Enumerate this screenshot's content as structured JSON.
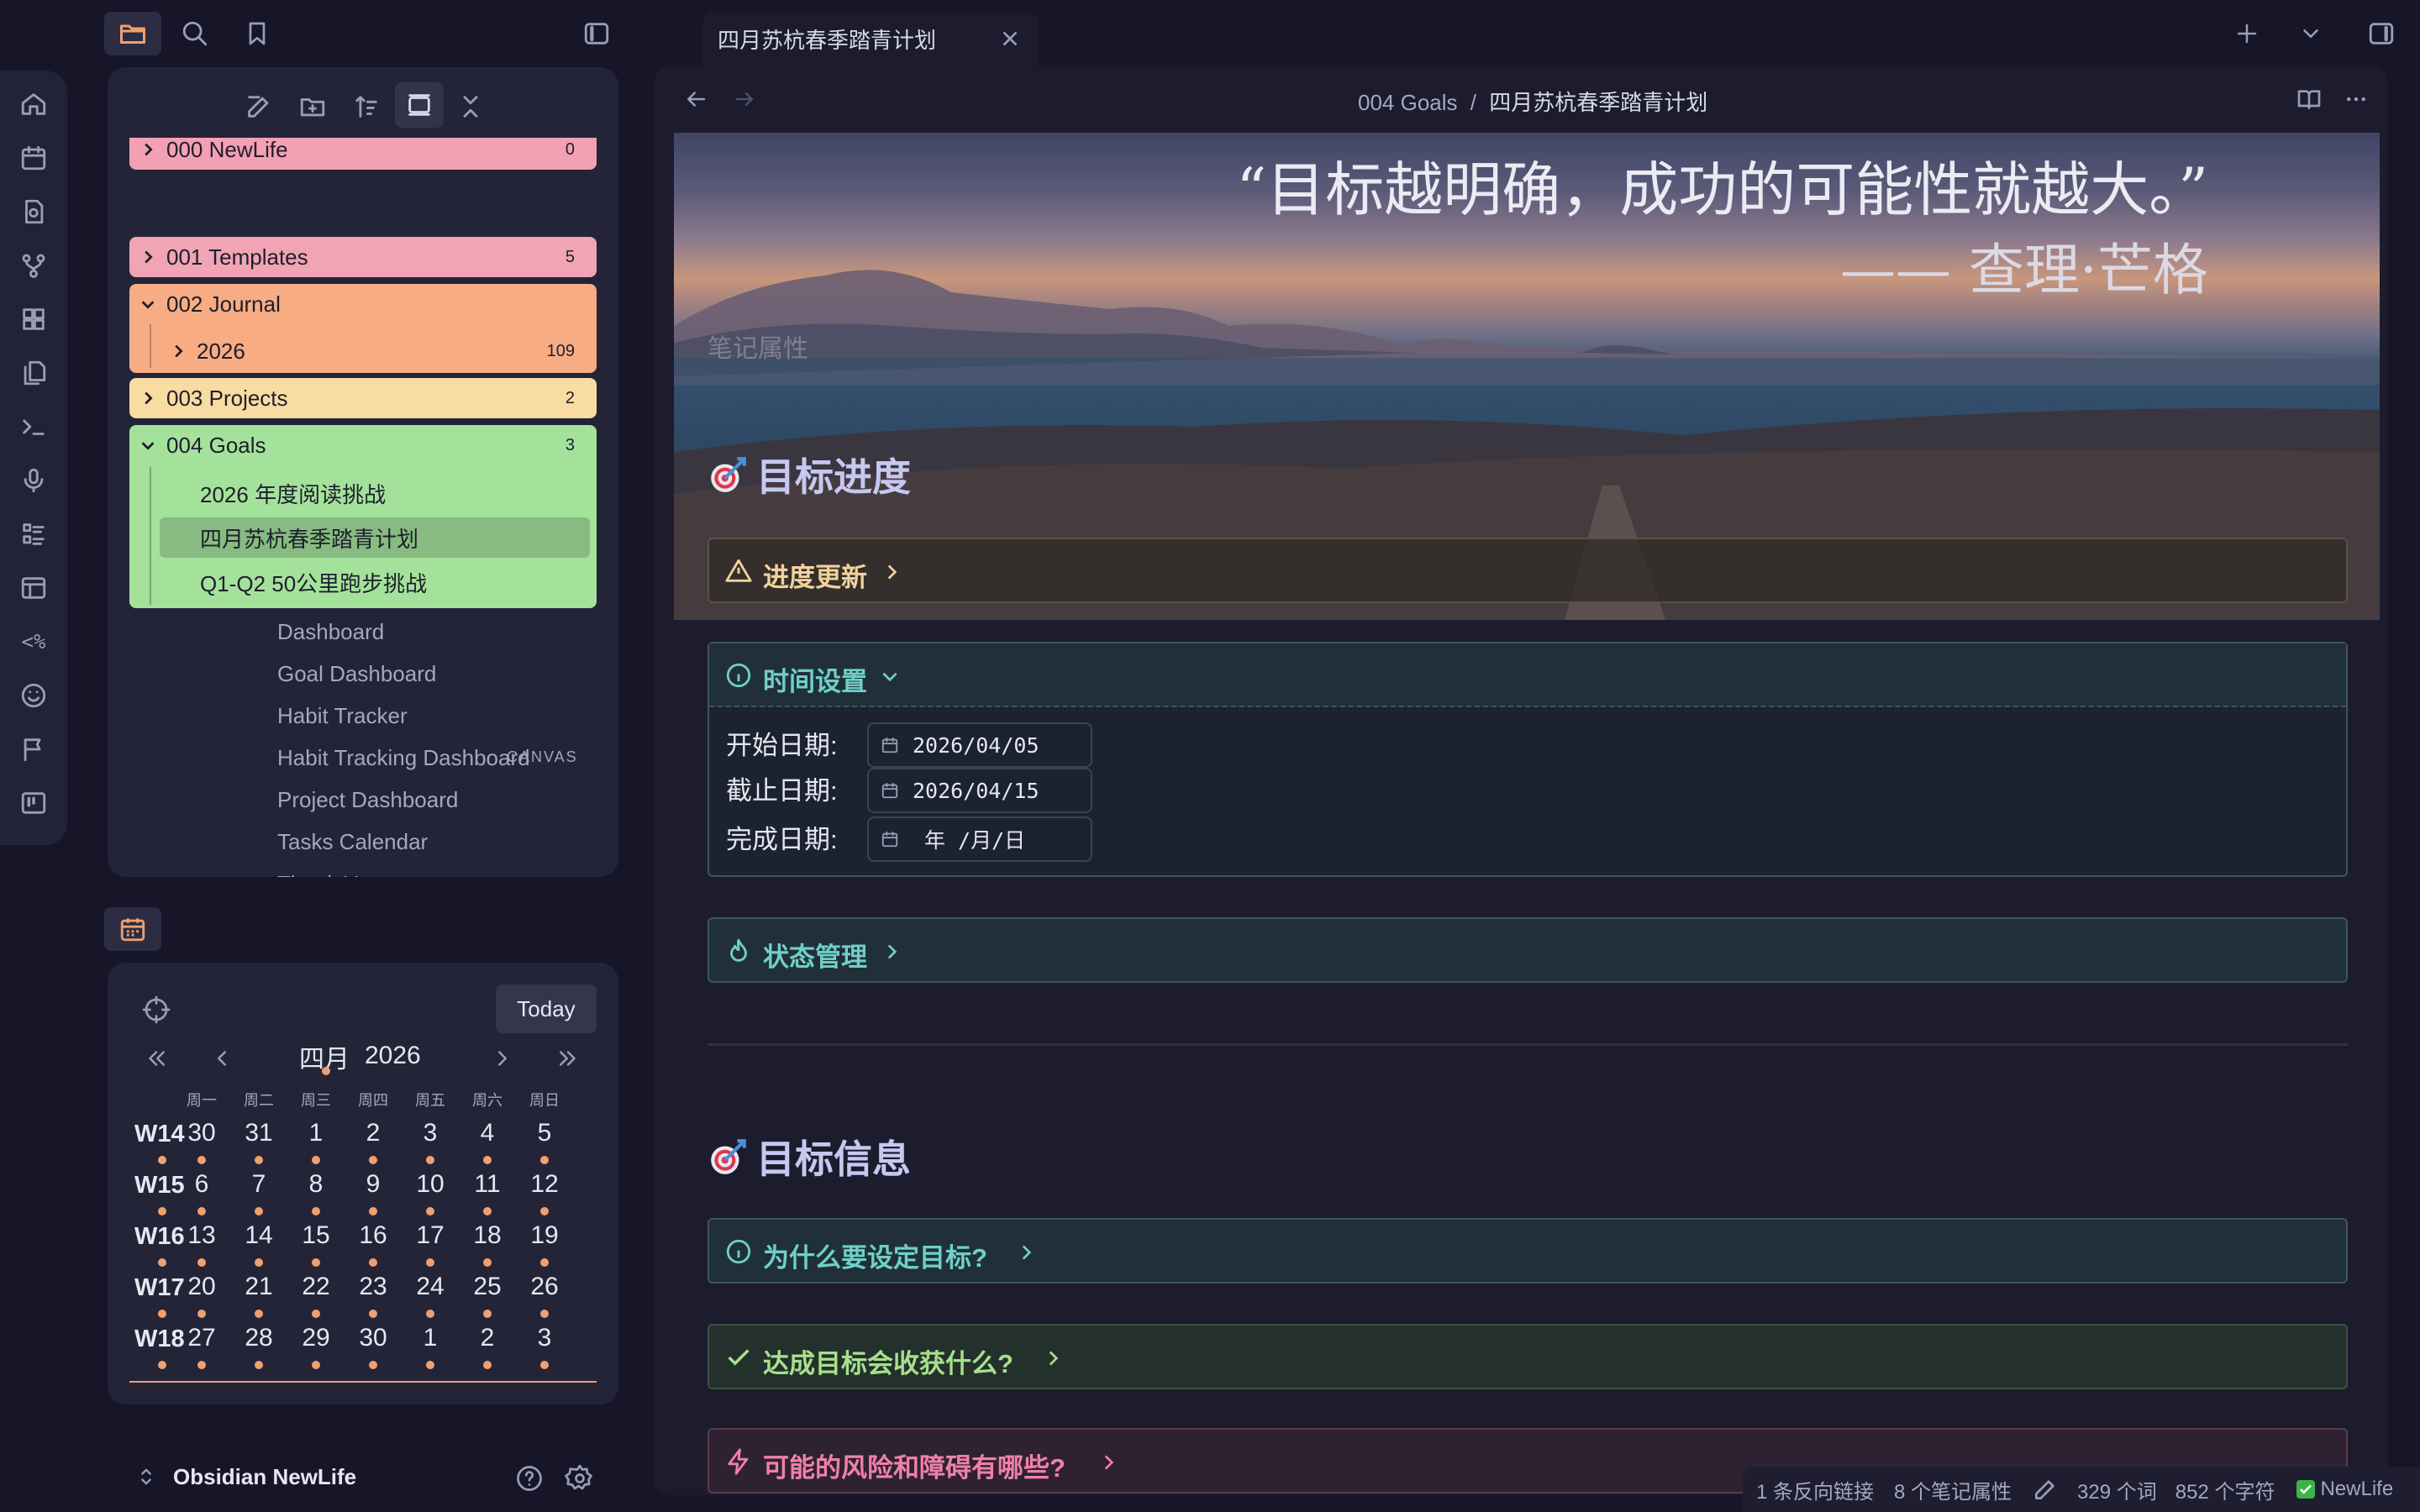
{
  "tab": {
    "title": "四月苏杭春季踏青计划"
  },
  "breadcrumb": {
    "parent": "004 Goals",
    "separator": "/",
    "current": "四月苏杭春季踏青计划"
  },
  "tree": [
    {
      "label": "000 NewLife",
      "count": "0",
      "color": "#f3a0b4"
    },
    {
      "label": "001 Templates",
      "count": "5",
      "color": "#f0a4b4"
    },
    {
      "label": "002 Journal",
      "count": "",
      "color": "#f7ac84"
    },
    {
      "label": "2026",
      "count": "109",
      "color": "#f7ac84"
    },
    {
      "label": "003 Projects",
      "count": "2",
      "color": "#f9dca2"
    },
    {
      "label": "004 Goals",
      "count": "3",
      "color": "#a4e29c"
    }
  ],
  "goals_children": [
    "2026 年度阅读挑战",
    "四月苏杭春季踏青计划",
    "Q1-Q2 50公里跑步挑战"
  ],
  "files": [
    "Dashboard",
    "Goal Dashboard",
    "Habit Tracker",
    "Habit Tracking Dashboard",
    "Project Dashboard",
    "Tasks Calendar",
    "Thank You"
  ],
  "canvas_badge": "CANVAS",
  "vault": {
    "name": "Obsidian NewLife"
  },
  "calendar": {
    "today_label": "Today",
    "month": "四月",
    "year": "2026",
    "weekdays": [
      "周一",
      "周二",
      "周三",
      "周四",
      "周五",
      "周六",
      "周日"
    ],
    "weeks": [
      {
        "label": "W14",
        "days": [
          "30",
          "31",
          "1",
          "2",
          "3",
          "4",
          "5"
        ]
      },
      {
        "label": "W15",
        "days": [
          "6",
          "7",
          "8",
          "9",
          "10",
          "11",
          "12"
        ]
      },
      {
        "label": "W16",
        "days": [
          "13",
          "14",
          "15",
          "16",
          "17",
          "18",
          "19"
        ]
      },
      {
        "label": "W17",
        "days": [
          "20",
          "21",
          "22",
          "23",
          "24",
          "25",
          "26"
        ]
      },
      {
        "label": "W18",
        "days": [
          "27",
          "28",
          "29",
          "30",
          "1",
          "2",
          "3"
        ]
      }
    ]
  },
  "note": {
    "quote": "“目标越明确，成功的可能性就越大。”",
    "author": "—— 查理·芒格",
    "properties_label": "笔记属性",
    "section1": "目标进度",
    "callout_progress": "进度更新",
    "callout_time": "时间设置",
    "start_label": "开始日期:",
    "start_value": "2026/04/05",
    "deadline_label": "截止日期:",
    "deadline_value": "2026/04/15",
    "done_label": "完成日期:",
    "done_value": "年 /月/日",
    "callout_status": "状态管理",
    "section2": "目标信息",
    "callout_why": "为什么要设定目标?",
    "callout_gain": "达成目标会收获什么?",
    "callout_risk": "可能的风险和障碍有哪些?"
  },
  "status": {
    "backlinks": "1 条反向链接",
    "properties": "8 个笔记属性",
    "words": "329 个词",
    "chars": "852 个字符",
    "vault": "NewLife"
  },
  "colors": {
    "accent": "#f0a070",
    "info": "#6ed0c8",
    "warning": "#f2d29a",
    "success": "#a6e08c",
    "danger": "#f080a8"
  }
}
